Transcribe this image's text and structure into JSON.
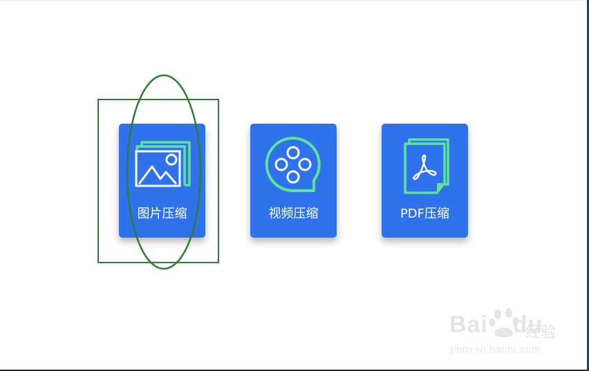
{
  "colors": {
    "tile_background": "#2f73ec",
    "icon_accent": "#5fe39a",
    "label_text": "#ffffff",
    "annotation_green": "#2e7d32"
  },
  "tiles": [
    {
      "id": "image",
      "icon": "image-stack-icon",
      "label": "图片压缩"
    },
    {
      "id": "video",
      "icon": "film-reel-icon",
      "label": "视频压缩"
    },
    {
      "id": "pdf",
      "icon": "pdf-document-icon",
      "label": "PDF压缩"
    }
  ],
  "watermark": {
    "brand_left": "Bai",
    "brand_right": "du",
    "suffix": "经验",
    "url": "jingyan.baidu.com"
  }
}
